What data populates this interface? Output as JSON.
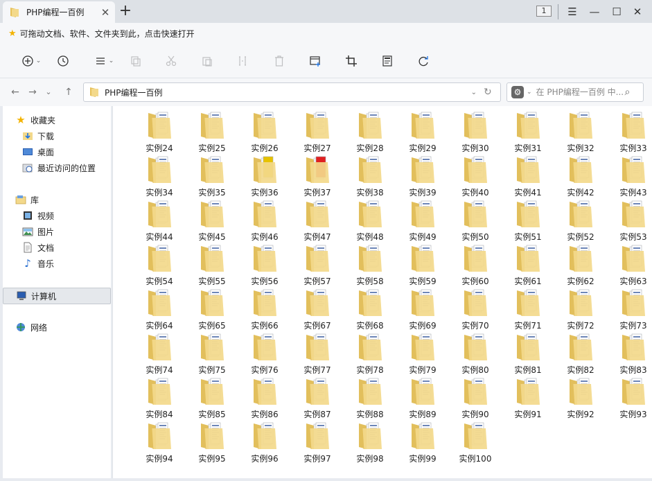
{
  "tab": {
    "title": "PHP编程一百例",
    "close": "✕",
    "new": "+"
  },
  "window": {
    "counter": "1",
    "menu": "☰",
    "minimize": "—",
    "maximize": "☐",
    "close": "✕"
  },
  "quickbar": {
    "text": "可拖动文档、软件、文件夹到此，点击快速打开"
  },
  "address": {
    "path": "PHP编程一百例"
  },
  "search": {
    "placeholder": "在 PHP编程一百例 中..."
  },
  "sidebar": {
    "favorites": {
      "label": "收藏夹",
      "items": [
        "下载",
        "桌面",
        "最近访问的位置"
      ]
    },
    "library": {
      "label": "库",
      "items": [
        "视频",
        "图片",
        "文档",
        "音乐"
      ]
    },
    "computer": {
      "label": "计算机"
    },
    "network": {
      "label": "网络"
    }
  },
  "folders": [
    "实例24",
    "实例25",
    "实例26",
    "实例27",
    "实例28",
    "实例29",
    "实例30",
    "实例31",
    "实例32",
    "实例33",
    "实例34",
    "实例35",
    "实例36",
    "实例37",
    "实例38",
    "实例39",
    "实例40",
    "实例41",
    "实例42",
    "实例43",
    "实例44",
    "实例45",
    "实例46",
    "实例47",
    "实例48",
    "实例49",
    "实例50",
    "实例51",
    "实例52",
    "实例53",
    "实例54",
    "实例55",
    "实例56",
    "实例57",
    "实例58",
    "实例59",
    "实例60",
    "实例61",
    "实例62",
    "实例63",
    "实例64",
    "实例65",
    "实例66",
    "实例67",
    "实例68",
    "实例69",
    "实例70",
    "实例71",
    "实例72",
    "实例73",
    "实例74",
    "实例75",
    "实例76",
    "实例77",
    "实例78",
    "实例79",
    "实例80",
    "实例81",
    "实例82",
    "实例83",
    "实例84",
    "实例85",
    "实例86",
    "实例87",
    "实例88",
    "实例89",
    "实例90",
    "实例91",
    "实例92",
    "实例93",
    "实例94",
    "实例95",
    "实例96",
    "实例97",
    "实例98",
    "实例99",
    "实例100"
  ],
  "special_folder_colors": {
    "实例36": "#e6c200",
    "实例37": "#e02020"
  },
  "colors": {
    "folder": "#f3d98b",
    "folder_dark": "#e2bf5c",
    "accent_star": "#f3b300"
  },
  "icons": {
    "toolbar": [
      "new-icon",
      "history-icon",
      "view-menu-icon",
      "copy-icon",
      "cut-icon",
      "paste-icon",
      "rename-icon",
      "delete-icon",
      "new-folder-icon",
      "crop-icon",
      "properties-icon",
      "sync-icon"
    ]
  }
}
